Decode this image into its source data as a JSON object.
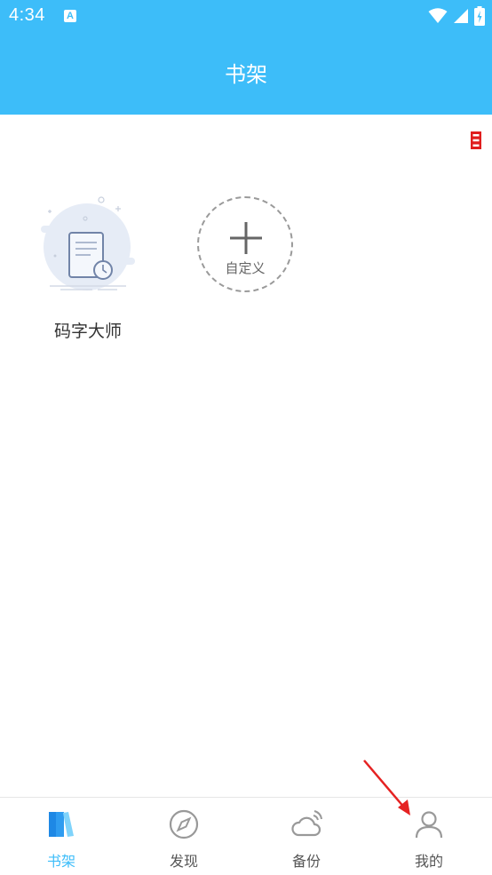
{
  "status_bar": {
    "time": "4:34",
    "notification_icon_letter": "A"
  },
  "header": {
    "title": "书架",
    "background_color": "#3dbdf9"
  },
  "shelf": {
    "books": [
      {
        "name": "码字大师"
      }
    ],
    "add_button_label": "自定义"
  },
  "bottom_nav": {
    "items": [
      {
        "label": "书架",
        "icon": "bookshelf-icon",
        "active": true
      },
      {
        "label": "发现",
        "icon": "compass-icon",
        "active": false
      },
      {
        "label": "备份",
        "icon": "cloud-backup-icon",
        "active": false
      },
      {
        "label": "我的",
        "icon": "user-icon",
        "active": false
      }
    ],
    "active_color": "#3dbdf9",
    "inactive_color": "#999999"
  },
  "annotation": {
    "arrow_color": "#e52222"
  }
}
